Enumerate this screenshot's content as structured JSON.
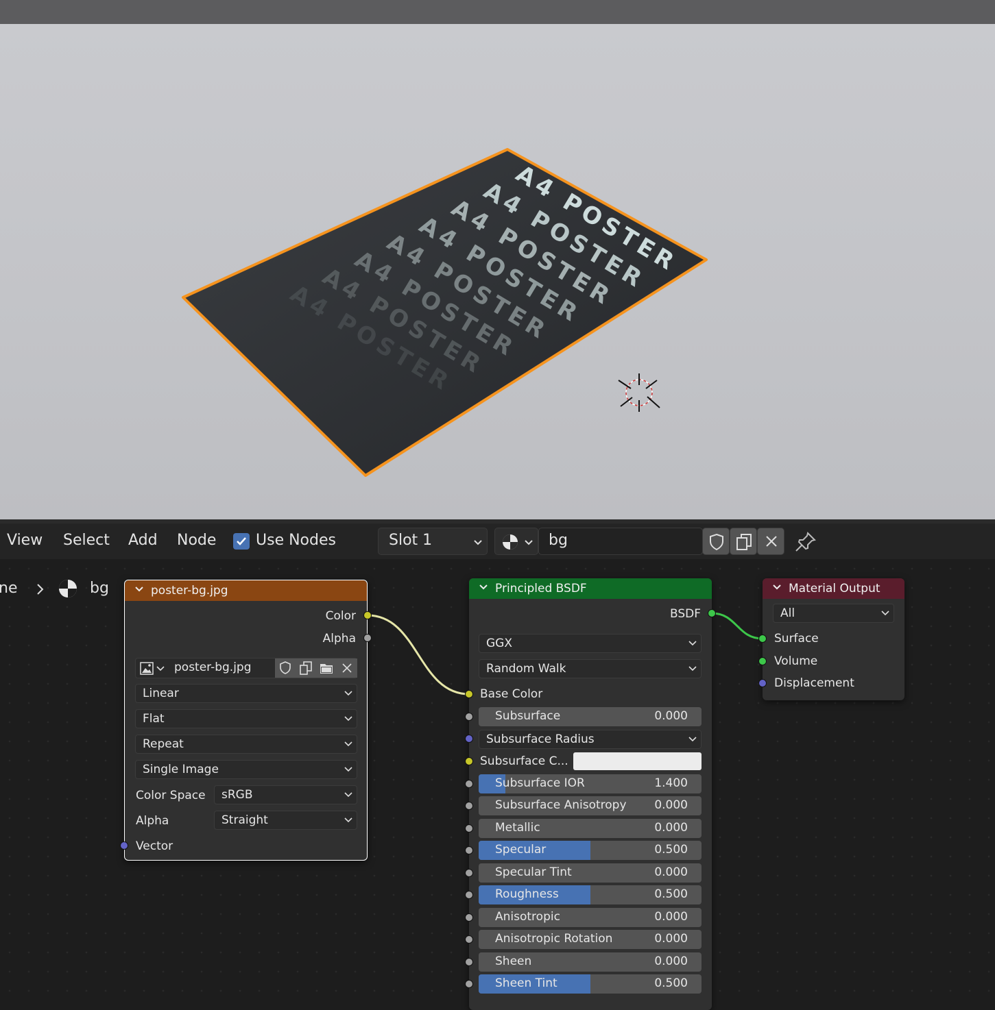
{
  "viewport": {
    "poster_lines": [
      "A4 POSTER",
      "A4 POSTER",
      "A4 POSTER",
      "A4 POSTER",
      "A4 POSTER",
      "A4 POSTER",
      "A4 POSTER",
      "A4 POSTER"
    ]
  },
  "header": {
    "menu": [
      "View",
      "Select",
      "Add",
      "Node"
    ],
    "use_nodes_label": "Use Nodes",
    "use_nodes_checked": true,
    "slot": "Slot 1",
    "material_name": "bg"
  },
  "breadcrumb": {
    "parent": "ne",
    "separator": ">",
    "material": "bg"
  },
  "image_node": {
    "title": "poster-bg.jpg",
    "outputs": [
      "Color",
      "Alpha"
    ],
    "image_name": "poster-bg.jpg",
    "interpolation": "Linear",
    "projection": "Flat",
    "extension": "Repeat",
    "source": "Single Image",
    "color_space_label": "Color Space",
    "color_space": "sRGB",
    "alpha_label": "Alpha",
    "alpha_mode": "Straight",
    "input": "Vector",
    "header_color": "#8a4612"
  },
  "bsdf_node": {
    "title": "Principled BSDF",
    "output": "BSDF",
    "distribution": "GGX",
    "subsurface_method": "Random Walk",
    "base_color_label": "Base Color",
    "subsurface_radius": "Subsurface Radius",
    "subsurface_color_label": "Subsurface C...",
    "header_color": "#0f6b26",
    "sliders": [
      {
        "label": "Subsurface",
        "value": "0.000",
        "fill": 0.0
      },
      {
        "label": "Subsurface IOR",
        "value": "1.400",
        "fill": 0.12
      },
      {
        "label": "Subsurface Anisotropy",
        "value": "0.000",
        "fill": 0.0
      },
      {
        "label": "Metallic",
        "value": "0.000",
        "fill": 0.0
      },
      {
        "label": "Specular",
        "value": "0.500",
        "fill": 0.5
      },
      {
        "label": "Specular Tint",
        "value": "0.000",
        "fill": 0.0
      },
      {
        "label": "Roughness",
        "value": "0.500",
        "fill": 0.5
      },
      {
        "label": "Anisotropic",
        "value": "0.000",
        "fill": 0.0
      },
      {
        "label": "Anisotropic Rotation",
        "value": "0.000",
        "fill": 0.0
      },
      {
        "label": "Sheen",
        "value": "0.000",
        "fill": 0.0
      },
      {
        "label": "Sheen Tint",
        "value": "0.500",
        "fill": 0.5
      }
    ]
  },
  "output_node": {
    "title": "Material Output",
    "target": "All",
    "inputs": [
      "Surface",
      "Volume",
      "Displacement"
    ],
    "header_color": "#5a1d2c"
  }
}
